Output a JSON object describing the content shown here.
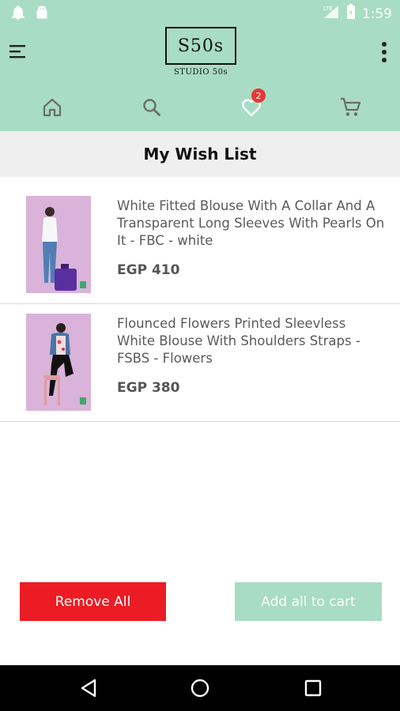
{
  "status_bar": {
    "time": "1:59",
    "left_icons": [
      "notification-bell-icon",
      "android-icon"
    ],
    "right_icons": [
      "signal-icon",
      "battery-icon"
    ]
  },
  "app_bar": {
    "background": "#a8dcc4",
    "logo": {
      "mark": "S50s",
      "subtitle": "STUDIO 50s"
    },
    "nav": [
      {
        "name": "home-icon"
      },
      {
        "name": "search-icon"
      },
      {
        "name": "heart-icon",
        "badge": "2"
      },
      {
        "name": "cart-icon"
      }
    ]
  },
  "page": {
    "title": "My Wish List"
  },
  "wishlist": {
    "items": [
      {
        "name": "White Fitted Blouse With A Collar And A Transparent Long Sleeves With Pearls On It - FBC - white",
        "price": "EGP 410"
      },
      {
        "name": "Flounced Flowers Printed Sleevless White Blouse With Shoulders Straps - FSBS - Flowers",
        "price": "EGP 380"
      }
    ]
  },
  "actions": {
    "remove_all": "Remove All",
    "add_all": "Add all to cart",
    "remove_color": "#ec1c24",
    "add_color": "#a8dcc4"
  }
}
